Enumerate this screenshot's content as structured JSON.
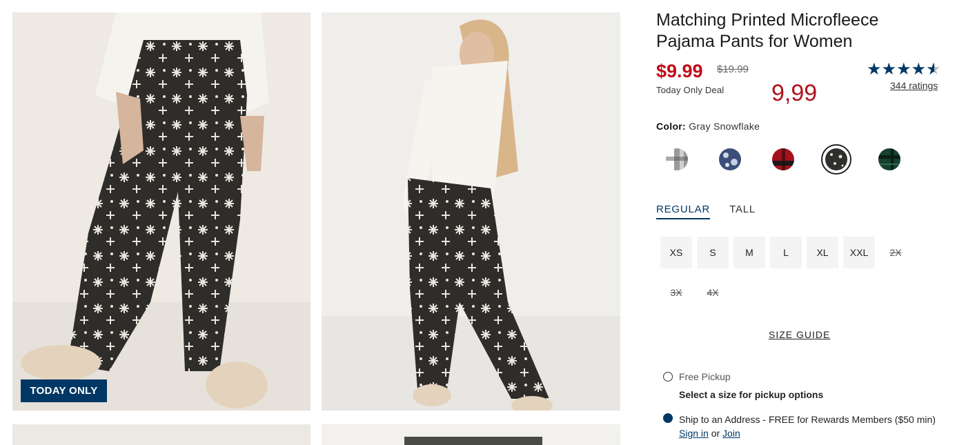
{
  "gallery": {
    "badge": "TODAY ONLY",
    "images": [
      {
        "icon": "pajama-front-photo"
      },
      {
        "icon": "pajama-back-photo"
      },
      {
        "icon": "product-photo-3"
      },
      {
        "icon": "product-photo-4"
      }
    ]
  },
  "product": {
    "title_line1": "Matching Printed Microfleece",
    "title_line2": "Pajama Pants for Women",
    "price": "$9.99",
    "original_price": "$19.99",
    "deal_text": "Today Only Deal",
    "alt_price": "9,99",
    "rating": 4.5,
    "rating_icon": "star-icon",
    "ratings_text": "344 ratings",
    "colors": {
      "accent": "#003764",
      "sale": "#c10b17"
    }
  },
  "color": {
    "label": "Color:",
    "selected": "Gray Snowflake",
    "swatches": [
      {
        "name": "gray-plaid",
        "color": "#8a8a8a"
      },
      {
        "name": "navy-print",
        "color": "#3b4f7a"
      },
      {
        "name": "red-plaid",
        "color": "#a3121d"
      },
      {
        "name": "gray-snowflake",
        "color": "#2f2f2c"
      },
      {
        "name": "green-plaid",
        "color": "#17402f"
      }
    ]
  },
  "fit_tabs": [
    "REGULAR",
    "TALL"
  ],
  "sizes": [
    {
      "label": "XS",
      "available": true
    },
    {
      "label": "S",
      "available": true
    },
    {
      "label": "M",
      "available": true
    },
    {
      "label": "L",
      "available": true
    },
    {
      "label": "XL",
      "available": true
    },
    {
      "label": "XXL",
      "available": true
    },
    {
      "label": "2X",
      "available": false
    },
    {
      "label": "3X",
      "available": false
    },
    {
      "label": "4X",
      "available": false
    }
  ],
  "size_guide": "SIZE GUIDE",
  "fulfillment": {
    "pickup_label": "Free Pickup",
    "pickup_hint": "Select a size for pickup options",
    "ship_label": "Ship to an Address - FREE for Rewards Members ($50 min)",
    "sign_in": "Sign in",
    "or": "or",
    "join": "Join"
  }
}
